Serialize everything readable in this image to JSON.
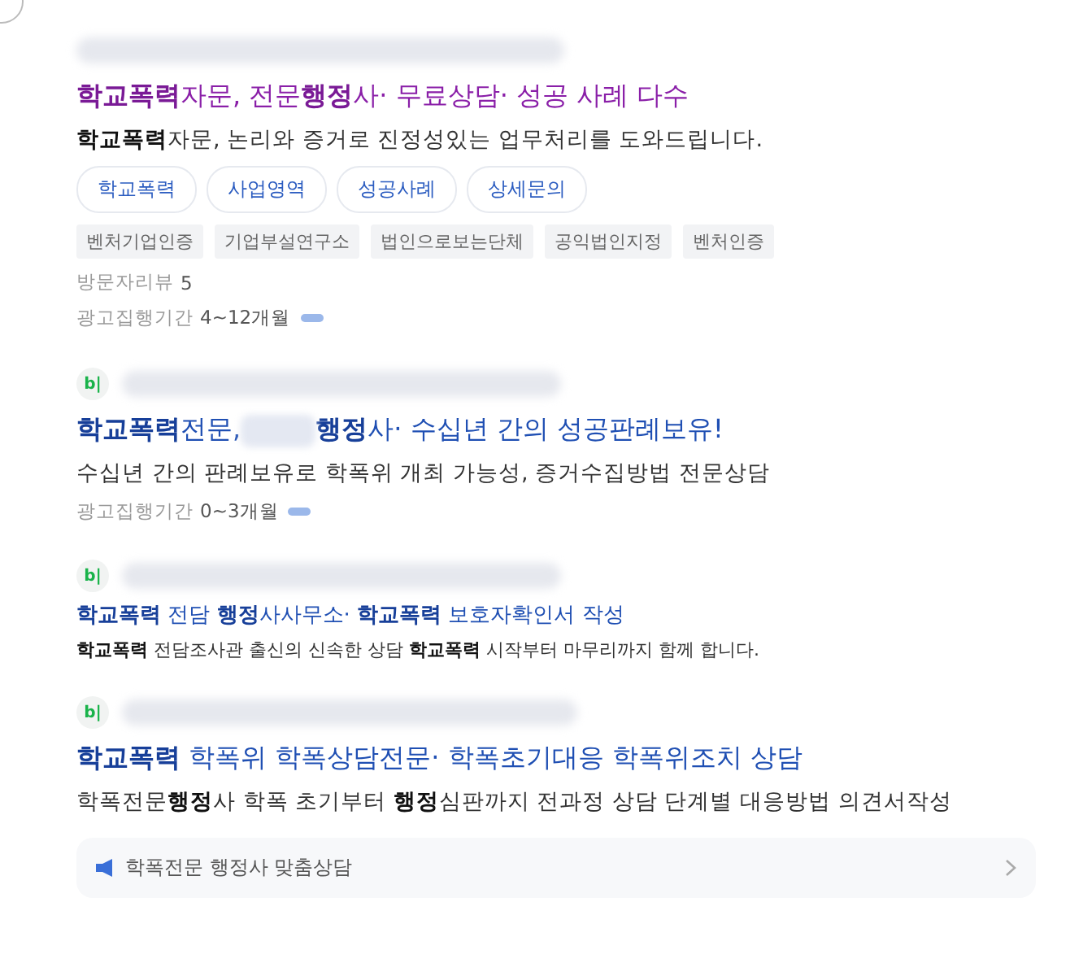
{
  "ads": [
    {
      "kind": "standard",
      "visited": true,
      "title": [
        "**학교폭력**자문, 전문**행정**사· 무료상담· 성공 사례 다수"
      ],
      "description": "**학교폭력**자문, 논리와 증거로 진정성있는 업무처리를 도와드립니다.",
      "chips": [
        "학교폭력",
        "사업영역",
        "성공사례",
        "상세문의"
      ],
      "tags": [
        "벤처기업인증",
        "기업부설연구소",
        "법인으로보는단체",
        "공익법인지정",
        "벤처인증"
      ],
      "meta": [
        {
          "label": "방문자리뷰",
          "value": "5",
          "bar": false
        },
        {
          "label": "광고집행기간",
          "value": "4~12개월",
          "bar": true
        }
      ]
    },
    {
      "kind": "standard",
      "logo": "b|",
      "visited": false,
      "title": [
        "**학교폭력**전문,",
        "**행정**사· 수십년 간의 성공판례보유!"
      ],
      "description": "수십년 간의 판례보유로 학폭위 개최 가능성, 증거수집방법 전문상담",
      "meta": [
        {
          "label": "광고집행기간",
          "value": "0~3개월",
          "bar": true
        }
      ]
    },
    {
      "kind": "compact",
      "logo": "b|",
      "visited": false,
      "title": [
        "**학교폭력** 전담 **행정**사사무소· **학교폭력** 보호자확인서 작성"
      ],
      "description": "**학교폭력** 전담조사관 출신의 신속한 상담 **학교폭력** 시작부터 마무리까지 함께 합니다."
    },
    {
      "kind": "standard",
      "logo": "b|",
      "visited": false,
      "title": [
        "**학교폭력** 학폭위 학폭상담전문· 학폭초기대응 학폭위조치 상담"
      ],
      "description": "학폭전문**행정**사 학폭 초기부터 **행정**심판까지 전과정 상담 단계별 대응방법 의견서작성",
      "footer_link": "학폭전문 행정사 맞춤상담"
    }
  ]
}
